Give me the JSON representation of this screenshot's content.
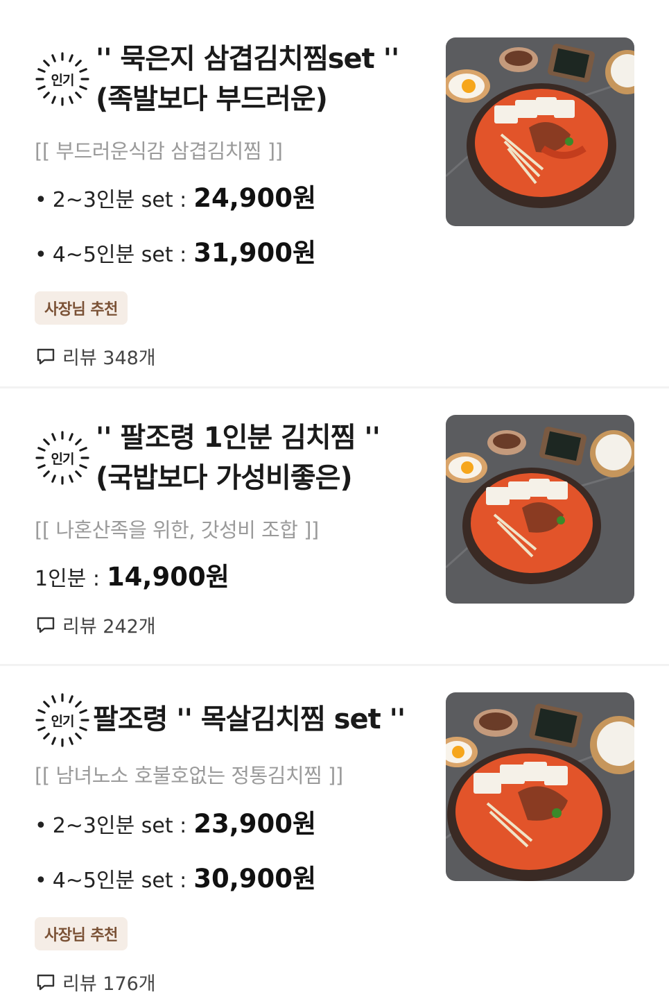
{
  "items": [
    {
      "badge": "인기",
      "title_line1": "'' 묵은지 삼겹김치찜set ''",
      "title_line2": "(족발보다 부드러운)",
      "desc": "[[ 부드러운식감 삼겹김치찜 ]]",
      "prices": [
        {
          "label": "2~3인분 set :",
          "value": "24,900원"
        },
        {
          "label": "4~5인분 set :",
          "value": "31,900원"
        }
      ],
      "recommend": "사장님 추천",
      "review": "리뷰 348개"
    },
    {
      "badge": "인기",
      "title_line1": "'' 팔조령 1인분 김치찜 ''",
      "title_line2": "(국밥보다 가성비좋은)",
      "desc": "[[ 나혼산족을 위한, 갓성비 조합 ]]",
      "prices": [
        {
          "label": "1인분 :",
          "value": "14,900원"
        }
      ],
      "review": "리뷰 242개"
    },
    {
      "badge": "인기",
      "title_line1": "팔조령 '' 목살김치찜 set ''",
      "desc": "[[ 남녀노소 호불호없는 정통김치찜 ]]",
      "prices": [
        {
          "label": "2~3인분 set :",
          "value": "23,900원"
        },
        {
          "label": "4~5인분 set :",
          "value": "30,900원"
        }
      ],
      "recommend": "사장님 추천",
      "review": "리뷰 176개"
    }
  ],
  "icons": {
    "badge": "popular-sunburst-icon",
    "review": "speech-bubble-icon",
    "thumbnail": "kimchi-jjim-food-photo"
  },
  "colors": {
    "recommend_bg": "#f5ede6",
    "recommend_text": "#7a5135",
    "desc_gray": "#9a9a9a"
  }
}
